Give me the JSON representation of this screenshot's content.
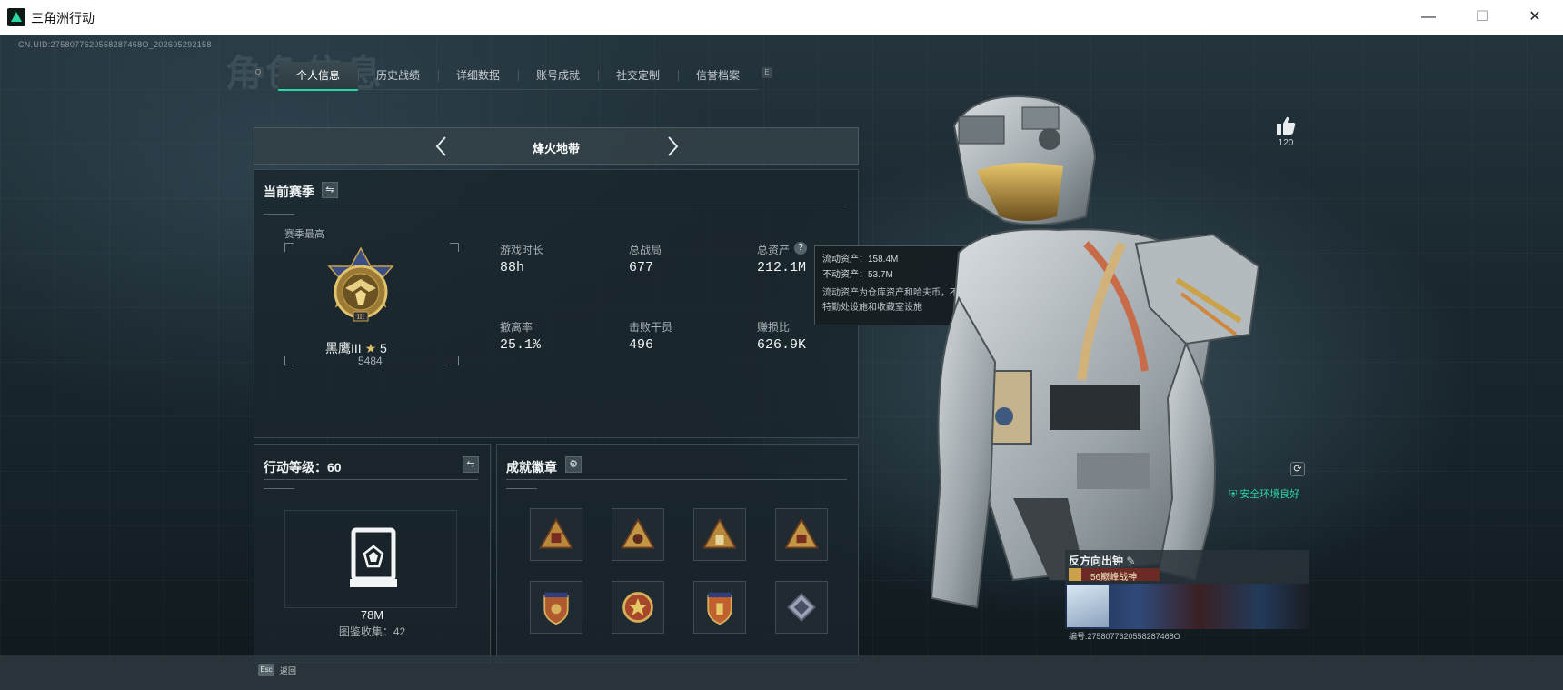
{
  "window": {
    "title": "三角洲行动",
    "minimize": "—",
    "maximize": "☐",
    "close": "✕"
  },
  "header": {
    "uid": "CN.UID:2758077620558287468O_202605292158",
    "bg_title": "角色信息",
    "tab_prev_key": "Q",
    "tab_next_key": "E",
    "tabs": [
      {
        "label": "个人信息",
        "active": true
      },
      {
        "label": "历史战绩",
        "active": false
      },
      {
        "label": "详细数据",
        "active": false
      },
      {
        "label": "账号成就",
        "active": false
      },
      {
        "label": "社交定制",
        "active": false
      },
      {
        "label": "信誉档案",
        "active": false
      }
    ]
  },
  "mode": {
    "label": "烽火地带"
  },
  "season": {
    "title": "当前赛季",
    "peak_label": "赛季最高",
    "rank_name": "黑鹰III",
    "rank_stars": "5",
    "rank_points": "5484",
    "stats": [
      {
        "label": "游戏时长",
        "value": "88h"
      },
      {
        "label": "总战局",
        "value": "677"
      },
      {
        "label": "总资产",
        "value": "212.1M"
      },
      {
        "label": "撤离率",
        "value": "25.1%"
      },
      {
        "label": "击败干员",
        "value": "496"
      },
      {
        "label": "赚损比",
        "value": "626.9K"
      }
    ],
    "help_glyph": "?"
  },
  "tooltip": {
    "liquid": "流动资产：158.4M",
    "fixed": "不动资产：53.7M",
    "desc": "流动资产为仓库资产和哈夫币，不动资产为特勤处设施和收藏室设施"
  },
  "level": {
    "title": "行动等级：60",
    "value": "78M",
    "collection": "图鉴收集：42"
  },
  "badges": {
    "title": "成就徽章",
    "items": [
      {
        "icon": "triangle-badge-icon"
      },
      {
        "icon": "triangle-badge-icon"
      },
      {
        "icon": "triangle-badge-icon"
      },
      {
        "icon": "triangle-badge-icon"
      },
      {
        "icon": "shield-badge-icon"
      },
      {
        "icon": "medal-badge-icon"
      },
      {
        "icon": "shield-badge-icon"
      },
      {
        "icon": "diamond-badge-icon"
      }
    ]
  },
  "likes": {
    "count": "120"
  },
  "player": {
    "status": "安全环境良好",
    "name": "反方向出钟",
    "title": "56巅峰战神",
    "id": "编号:2758077620558287468O"
  },
  "footer": {
    "esc_key": "Esc",
    "back": "返回"
  },
  "colors": {
    "accent": "#2ad6a3",
    "gold": "#c9a24a",
    "panel": "#1a262c"
  }
}
